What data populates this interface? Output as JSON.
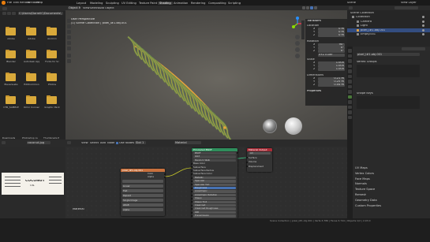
{
  "menus": [
    "File",
    "Edit",
    "Render",
    "Window",
    "Help"
  ],
  "workspaces": [
    "Layout",
    "Modeling",
    "Sculpting",
    "UV Editing",
    "Texture Paint",
    "Shading",
    "Animation",
    "Rendering",
    "Compositing",
    "Scripting"
  ],
  "active_workspace": "Shading",
  "scene_name": "Scene",
  "view_layer": "View Layer",
  "file_browser": {
    "path": "C:\\Users\\DarrellC\\Documents\\",
    "folders": [
      "Adobe",
      "Adobe",
      "ALCC11",
      "Blender",
      "Autodesk Appl",
      "Fonts for Sc",
      "ElevenLabs",
      "EditCommon",
      "Photos",
      "CTR_SAMPLE",
      "Omni Connect",
      "Graphic Pack"
    ],
    "bottom_labels": [
      "Downloads",
      "Photoshop Audio",
      "Thumbnails Pro"
    ]
  },
  "viewport": {
    "mode": "Object Mode",
    "menus": [
      "View",
      "Select",
      "Add",
      "Object"
    ],
    "perspective": "User Perspective",
    "object_info": "(1) Scene Collection | pixel_l#1.obj.001"
  },
  "transform": {
    "header": "Transform",
    "location_label": "Location",
    "location": [
      "0 m",
      "0 m",
      "0 m"
    ],
    "rotation_label": "Rotation",
    "rotation": [
      "90°",
      "0°",
      "0°"
    ],
    "mode_label": "XYZ Euler",
    "scale_label": "Scale",
    "scale": [
      "1.000",
      "1.000",
      "1.000"
    ],
    "dimensions_label": "Dimensions",
    "dimensions": [
      "0.21 m",
      "0.25 m",
      "0.04 m"
    ],
    "axes": [
      "X",
      "Y",
      "Z"
    ],
    "properties_label": "Properties"
  },
  "outliner": {
    "title": "Scene Collection",
    "items": [
      "Collection",
      "Camera",
      "Light",
      "pixel_l#1.obj.001",
      "Empty.001"
    ]
  },
  "properties": {
    "object_name": "pixel_l#1.obj.001",
    "vertex_groups": "Vertex Groups",
    "shape_keys": "Shape Keys",
    "sections": [
      "UV Maps",
      "Vertex Colors",
      "Face Maps",
      "Normals",
      "Texture Space",
      "Remesh",
      "Geometry Data",
      "Custom Properties"
    ]
  },
  "image_editor": {
    "image_name": "coconut.jpg",
    "label_title": "COCONUT",
    "label_subtitle": "OIL"
  },
  "node_editor": {
    "menus": [
      "View",
      "Select",
      "Add",
      "Node"
    ],
    "use_nodes": "Use Nodes",
    "slot": "Slot 1",
    "material": "Material",
    "footer_label": "Material"
  },
  "nodes": {
    "principled": {
      "title": "Principled BSDF",
      "inputs": [
        "BSDF",
        "GGX",
        "Random Walk",
        "Base Color",
        "Subsurface",
        "Subsurface Radius",
        "Subsurface Color",
        "Metallic",
        "Specular",
        "Specular Tint",
        "Roughness",
        "Anisotropic",
        "Anisotropic Rotation",
        "Sheen",
        "Sheen Tint",
        "Clearcoat",
        "Clearcoat Roughness",
        "IOR",
        "Transmission"
      ]
    },
    "output": {
      "title": "Material Output",
      "items": [
        "All",
        "Surface",
        "Volume",
        "Displacement"
      ]
    },
    "texture": {
      "title": "pixel_l#1.obj.001",
      "outputs": [
        "Color",
        "Alpha"
      ],
      "fields": [
        "Linear",
        "Flat",
        "Repeat",
        "Single Image",
        "sRGB",
        "Alpha"
      ]
    }
  },
  "status": {
    "right": "Scene Collection | pixel_l#1.obj.001 | Verts:3,786 | Faces:3,744 | Objects:1/2 | 2.93.0"
  }
}
